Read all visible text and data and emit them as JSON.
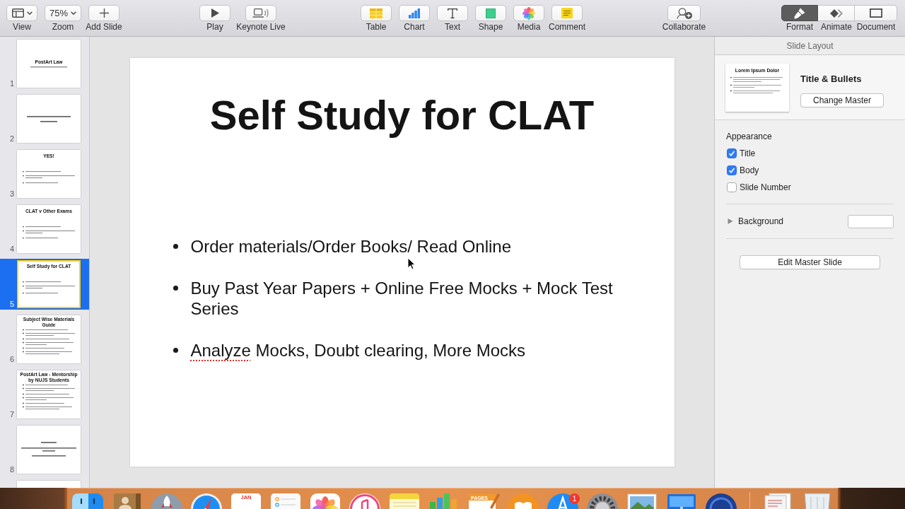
{
  "toolbar": {
    "groups": [
      {
        "items": [
          {
            "kind": "view",
            "label": "View"
          },
          {
            "kind": "zoom",
            "label": "Zoom",
            "value": "75%"
          },
          {
            "kind": "add-slide",
            "label": "Add Slide"
          }
        ]
      },
      {
        "items": [
          {
            "kind": "play",
            "label": "Play"
          },
          {
            "kind": "live",
            "label": "Keynote Live"
          }
        ]
      },
      {
        "items": [
          {
            "kind": "table",
            "label": "Table"
          },
          {
            "kind": "chart",
            "label": "Chart"
          },
          {
            "kind": "text",
            "label": "Text"
          },
          {
            "kind": "shape",
            "label": "Shape"
          },
          {
            "kind": "media",
            "label": "Media"
          },
          {
            "kind": "comment",
            "label": "Comment"
          }
        ]
      },
      {
        "items": [
          {
            "kind": "collaborate",
            "label": "Collaborate"
          }
        ]
      }
    ],
    "inspector_tabs": [
      {
        "kind": "format",
        "label": "Format",
        "selected": true
      },
      {
        "kind": "animate",
        "label": "Animate",
        "selected": false
      },
      {
        "kind": "document",
        "label": "Document",
        "selected": false
      }
    ]
  },
  "navigator": {
    "slides": [
      {
        "number": "1",
        "kind": "title",
        "selected": false,
        "title": "PostArt Law"
      },
      {
        "number": "2",
        "kind": "statement",
        "selected": false
      },
      {
        "number": "3",
        "kind": "bullets",
        "selected": false,
        "title": "YES!"
      },
      {
        "number": "4",
        "kind": "bullets",
        "selected": false,
        "title": "CLAT v Other Exams"
      },
      {
        "number": "5",
        "kind": "bullets",
        "selected": true,
        "title": "Self Study for CLAT"
      },
      {
        "number": "6",
        "kind": "dense-bullets",
        "selected": false,
        "title": "Subject Wise Materials Guide"
      },
      {
        "number": "7",
        "kind": "dense-bullets",
        "selected": false,
        "title": "PostArt Law - Mentorship by NUJS Students"
      },
      {
        "number": "8",
        "kind": "notice",
        "selected": false
      },
      {
        "kind": "cut-off",
        "selected": false
      }
    ]
  },
  "slide": {
    "title": "Self Study for CLAT",
    "bullets": [
      {
        "runs": [
          {
            "text": "Order materials/Order Books/ Read Online",
            "misspelled": false
          }
        ]
      },
      {
        "runs": [
          {
            "text": "Buy Past Year Papers + Online Free Mocks + Mock Test Series",
            "misspelled": false
          }
        ]
      },
      {
        "runs": [
          {
            "text": "Analyze",
            "misspelled": true
          },
          {
            "text": " Mocks, Doubt clearing, More Mocks",
            "misspelled": false
          }
        ]
      }
    ]
  },
  "inspector": {
    "title": "Slide Layout",
    "layout": {
      "preview_title": "Lorem Ipsum Dolor",
      "name": "Title & Bullets",
      "button": "Change Master"
    },
    "appearance": {
      "heading": "Appearance",
      "options": [
        {
          "label": "Title",
          "checked": true
        },
        {
          "label": "Body",
          "checked": true
        },
        {
          "label": "Slide Number",
          "checked": false
        }
      ]
    },
    "background": {
      "label": "Background",
      "expanded": false
    },
    "edit_button": "Edit Master Slide"
  },
  "dock": {
    "items": [
      {
        "kind": "finder"
      },
      {
        "kind": "contacts"
      },
      {
        "kind": "launchpad"
      },
      {
        "kind": "safari"
      },
      {
        "kind": "calendar",
        "text": "JAN"
      },
      {
        "kind": "reminders"
      },
      {
        "kind": "photos"
      },
      {
        "kind": "music"
      },
      {
        "kind": "notes"
      },
      {
        "kind": "numbers"
      },
      {
        "kind": "pages",
        "text": "PAGES"
      },
      {
        "kind": "books"
      },
      {
        "kind": "app-store",
        "badge": "1"
      },
      {
        "kind": "preferences"
      },
      {
        "kind": "preview"
      },
      {
        "kind": "keynote"
      },
      {
        "kind": "disc"
      },
      {
        "kind": "separator"
      },
      {
        "kind": "downloads"
      },
      {
        "kind": "trash"
      }
    ]
  }
}
